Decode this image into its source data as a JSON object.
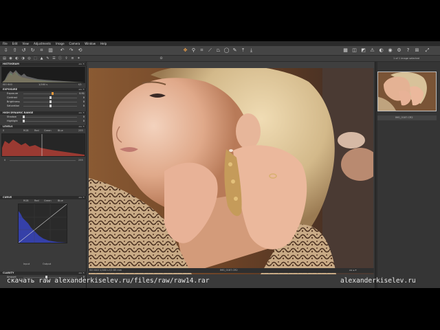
{
  "menubar": {
    "items": [
      "File",
      "Edit",
      "View",
      "Adjustments",
      "Image",
      "Camera",
      "Window",
      "Help"
    ]
  },
  "toolbar": {
    "left_icons": [
      "import-icon",
      "export-icon",
      "rotate-left-icon",
      "rotate-right-icon",
      "crop-icon",
      "delete-icon",
      "undo-icon",
      "redo-icon",
      "reset-icon"
    ],
    "center_icons": [
      "pan-icon",
      "zoom-icon",
      "crop-tool-icon",
      "straighten-icon",
      "keystone-icon",
      "spot-removal-icon",
      "white-balance-picker-icon",
      "copy-adjustments-icon",
      "apply-adjustments-icon"
    ],
    "right_icons": [
      "grid-icon",
      "compare-icon",
      "focus-mask-icon",
      "exposure-warning-icon",
      "proof-icon",
      "color-icon",
      "settings-icon",
      "help-icon"
    ]
  },
  "left_panel": {
    "histogram_title": "HISTOGRAM",
    "histogram_readout": {
      "iso": "ISO 640",
      "shutter": "1/160 s",
      "aperture": "f/2"
    },
    "exposure": {
      "title": "EXPOSURE",
      "rows": [
        {
          "label": "Exposure",
          "value": "0.51",
          "knob_pos": 0.55,
          "accent": true
        },
        {
          "label": "Contrast",
          "value": "0",
          "knob_pos": 0.5,
          "accent": false
        },
        {
          "label": "Brightness",
          "value": "0",
          "knob_pos": 0.5,
          "accent": false
        },
        {
          "label": "Saturation",
          "value": "0",
          "knob_pos": 0.5,
          "accent": false
        }
      ]
    },
    "hdr": {
      "title": "HIGH DYNAMIC RANGE",
      "rows": [
        {
          "label": "Shadow",
          "value": "0"
        },
        {
          "label": "Highlight",
          "value": "0"
        }
      ]
    },
    "levels": {
      "title": "LEVELS",
      "top_left": "0",
      "top_right": "255",
      "bottom_left": "0",
      "bottom_right": "255",
      "mode_tabs": [
        "RGB",
        "Red",
        "Green",
        "Blue"
      ]
    },
    "curve": {
      "title": "CURVE",
      "tabs": [
        "RGB",
        "Red",
        "Green",
        "Blue"
      ],
      "input_label": "Input",
      "output_label": "Output"
    },
    "clarity": {
      "title": "CLARITY",
      "row_label": "Amount",
      "value": "0"
    }
  },
  "viewer": {
    "status_left": "ISO 640  1/160 s  f/2  85 mm",
    "status_center": "IMG_0187.CR2"
  },
  "right_panel": {
    "count_label": "1 of 1 image selected",
    "thumb_filename": "IMG_0187.CR2"
  },
  "colors": {
    "accent": "#e8983a",
    "panel_bg": "#3a3a3a",
    "header_bg": "#2b2b2b"
  },
  "caption": {
    "left": "скачать raw alexanderkiselev.ru/files/raw/raw14.rar",
    "right": "alexanderkiselev.ru"
  }
}
